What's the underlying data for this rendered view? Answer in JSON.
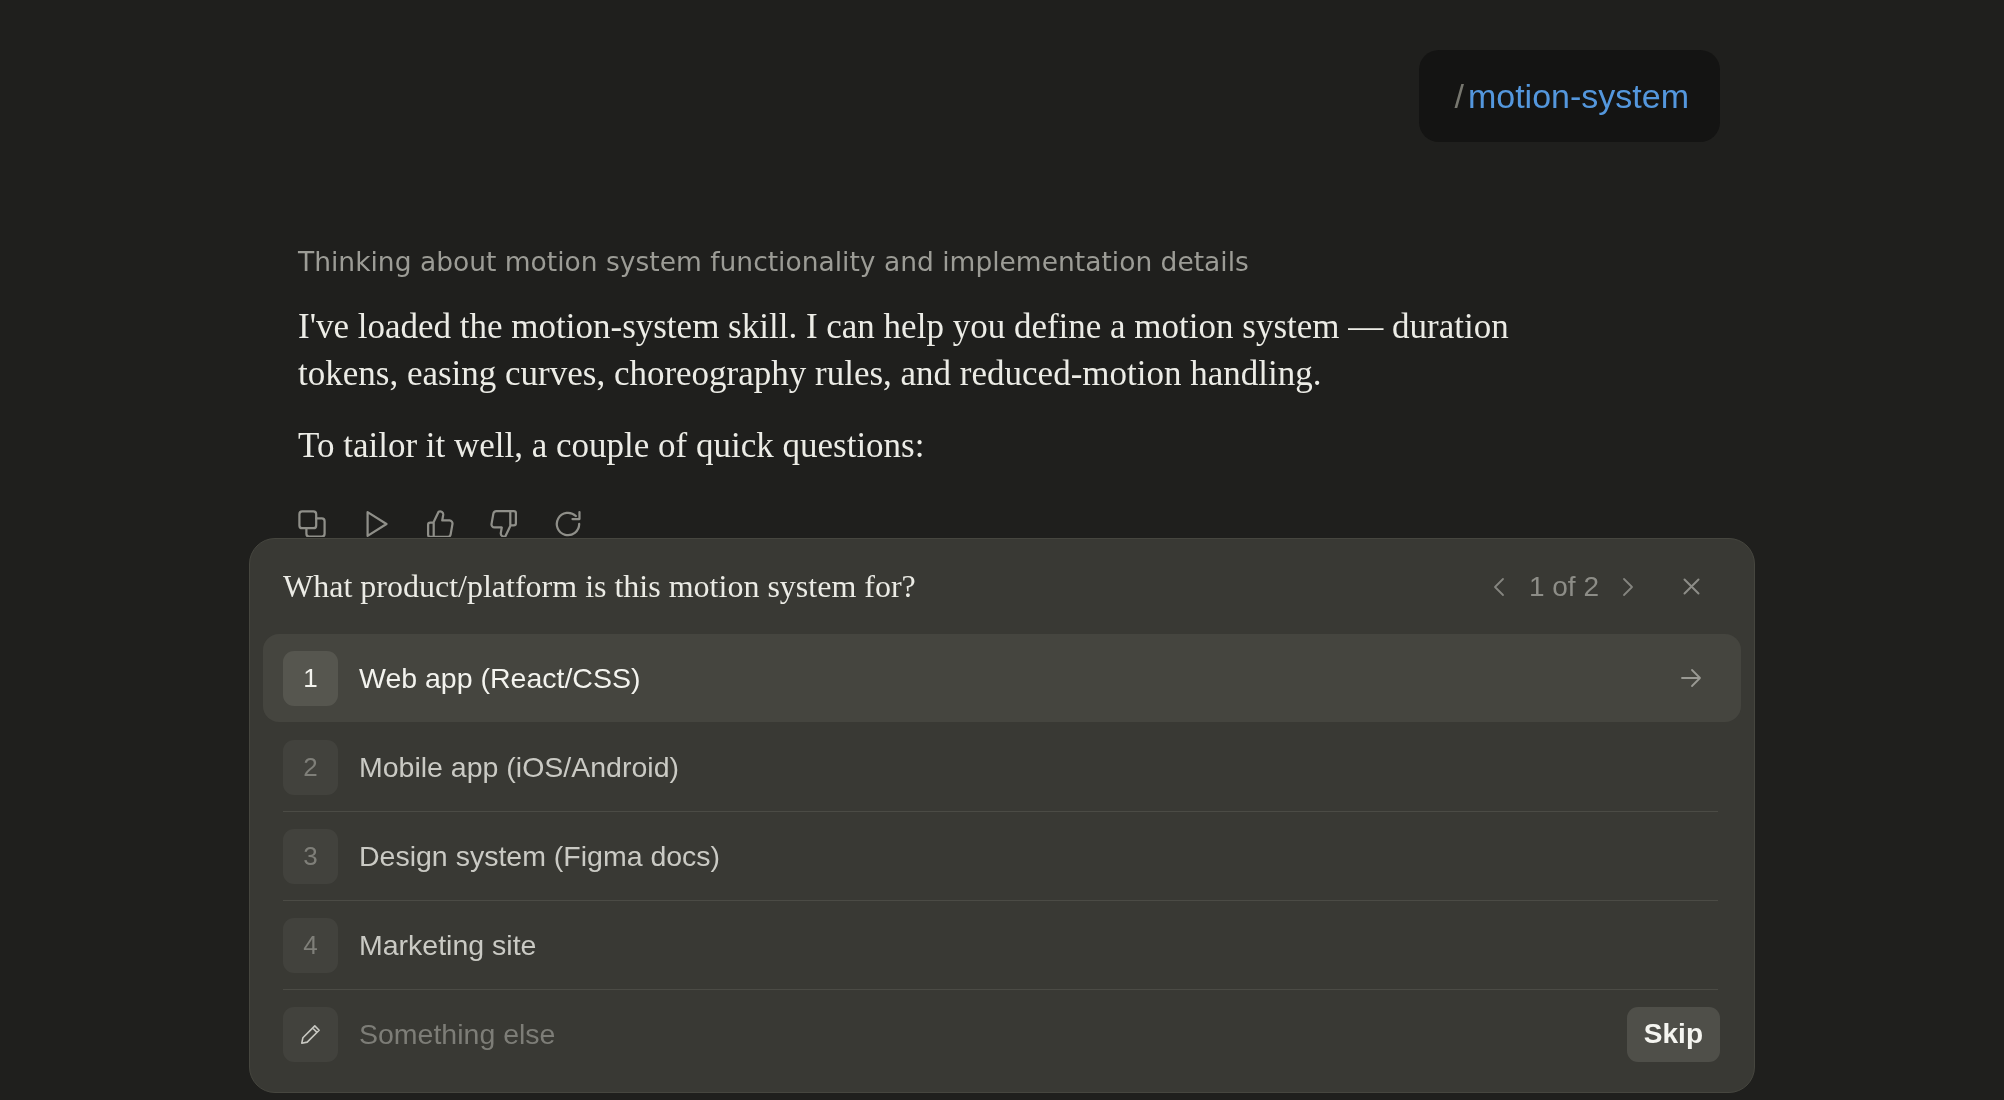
{
  "user_message": {
    "slash": "/",
    "command": "motion-system"
  },
  "thinking_summary": "Thinking about motion system functionality and implementation details",
  "paragraphs": [
    "I've loaded the motion-system skill. I can help you define a motion system — duration tokens, easing curves, choreography rules, and reduced-motion handling.",
    "To tailor it well, a couple of quick questions:"
  ],
  "question_card": {
    "question": "What product/platform is this motion system for?",
    "pager": "1 of 2",
    "options": [
      {
        "number": "1",
        "label": "Web app (React/CSS)",
        "selected": true
      },
      {
        "number": "2",
        "label": "Mobile app (iOS/Android)",
        "selected": false
      },
      {
        "number": "3",
        "label": "Design system (Figma docs)",
        "selected": false
      },
      {
        "number": "4",
        "label": "Marketing site",
        "selected": false
      }
    ],
    "custom_answer": {
      "placeholder": "Something else"
    },
    "skip_button": "Skip"
  }
}
